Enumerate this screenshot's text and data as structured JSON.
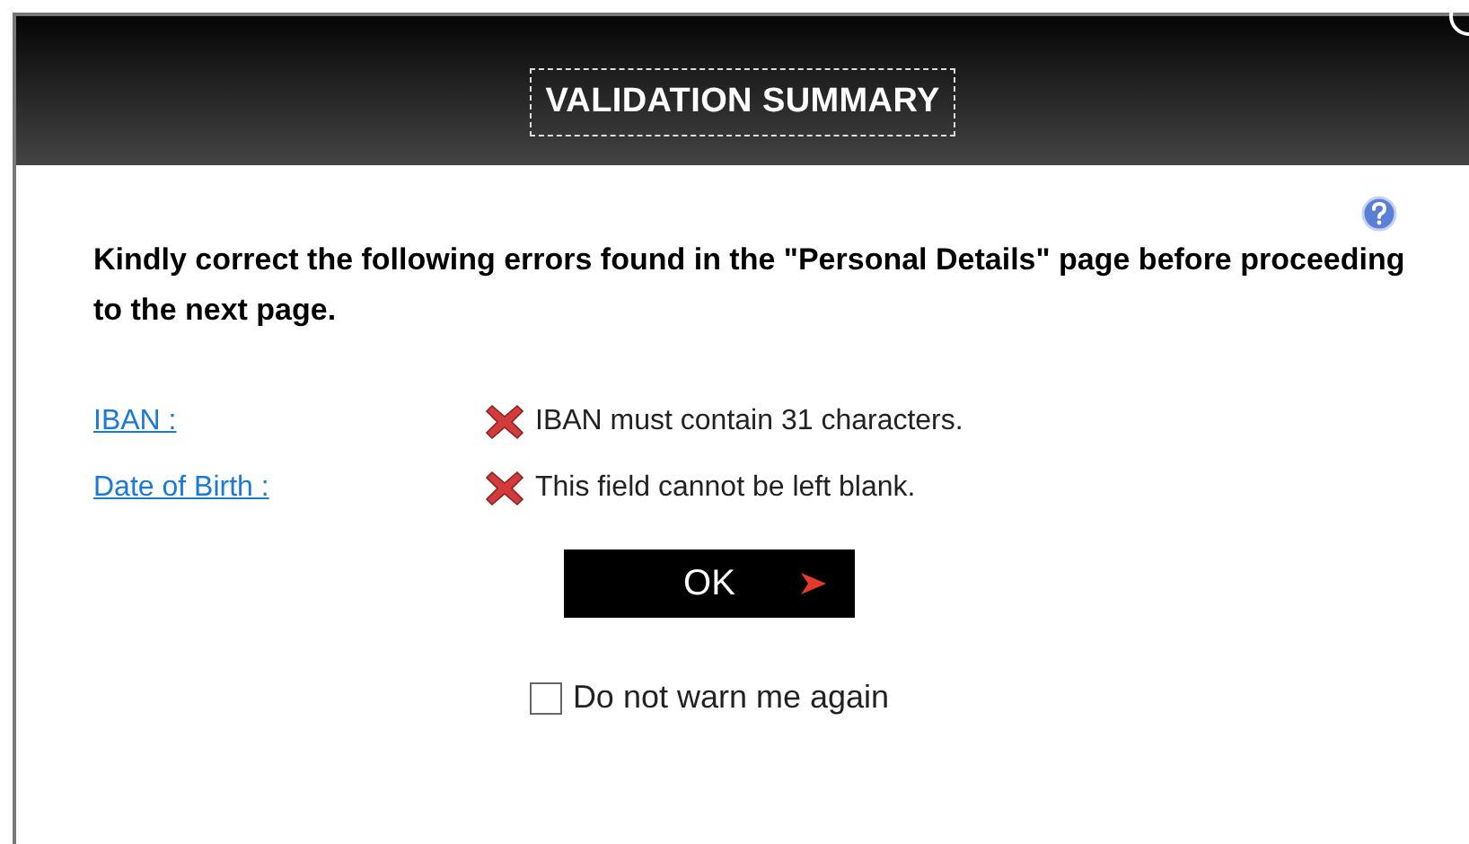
{
  "dialog": {
    "title": "VALIDATION SUMMARY"
  },
  "message": "Kindly correct the following errors found in the \"Personal Details\" page before proceeding to the next page.",
  "errors": [
    {
      "field": "IBAN :",
      "text": "IBAN must contain 31 characters."
    },
    {
      "field": "Date of Birth :",
      "text": "This field cannot be left blank."
    }
  ],
  "ok_button": {
    "label": "OK"
  },
  "dont_warn": {
    "label": "Do not warn me again",
    "checked": false
  }
}
